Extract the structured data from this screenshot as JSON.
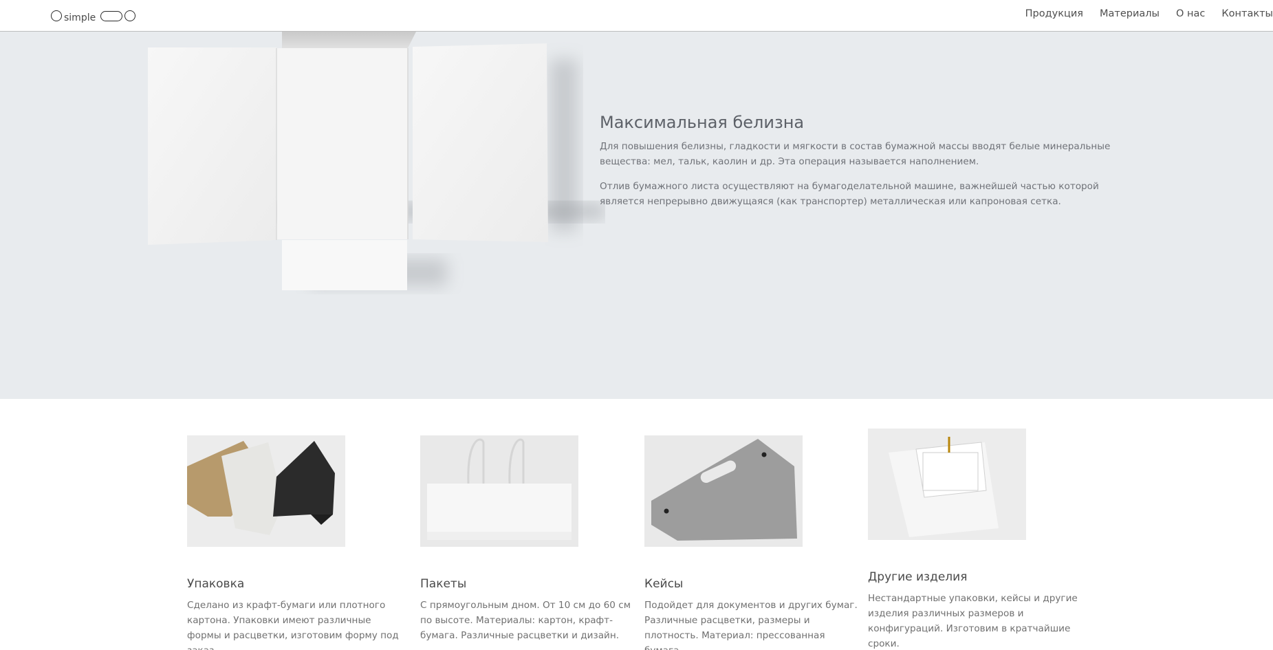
{
  "header": {
    "logo_text": "simple",
    "nav": [
      "Продукция",
      "Материалы",
      "О нас",
      "Контакты"
    ]
  },
  "hero": {
    "title": "Максимальная белизна",
    "paragraphs": [
      "Для повышения белизны, гладкости и мягкости в состав бумажной массы вводят белые минеральные вещества: мел, тальк, каолин и др. Эта операция называется наполнением.",
      "Отлив бумажного листа осуществляют на бумагоделательной машине, важнейшей частью которой является непрерывно движущаяся (как транспортер) металлическая или капроновая сетка."
    ]
  },
  "products": [
    {
      "title": "Упаковка",
      "description": "Сделано из крафт-бумаги или плотного картона. Упаковки имеют различные формы и расцветки, изготовим форму под заказ."
    },
    {
      "title": "Пакеты",
      "description": "С прямоугольным дном. От 10 см до 60 см по высоте. Материалы: картон, крафт-бумага. Различные расцветки и дизайн."
    },
    {
      "title": "Кейсы",
      "description": "Подойдет для документов и других бумаг. Различные расцветки, размеры и плотность. Материал: прессованная бумага."
    },
    {
      "title": "Другие изделия",
      "description": "Нестандартные упаковки, кейсы и другие изделия различных размеров и конфигураций. Изготовим в кратчайшие сроки."
    }
  ]
}
